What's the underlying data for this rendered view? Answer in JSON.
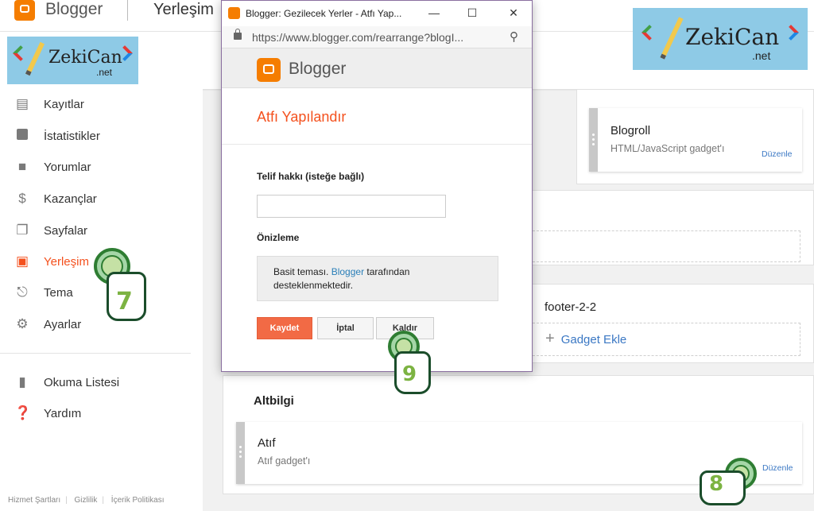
{
  "app": {
    "brand": "Blogger",
    "page_title": "Yerleşim"
  },
  "sidebar": {
    "items": [
      {
        "label": "Kayıtlar",
        "icon": "posts-icon"
      },
      {
        "label": "İstatistikler",
        "icon": "stats-icon"
      },
      {
        "label": "Yorumlar",
        "icon": "comments-icon"
      },
      {
        "label": "Kazançlar",
        "icon": "dollar-icon"
      },
      {
        "label": "Sayfalar",
        "icon": "pages-icon"
      },
      {
        "label": "Yerleşim",
        "icon": "layout-icon",
        "active": true
      },
      {
        "label": "Tema",
        "icon": "paint-roller-icon"
      },
      {
        "label": "Ayarlar",
        "icon": "gear-icon"
      }
    ],
    "secondary": [
      {
        "label": "Okuma Listesi",
        "icon": "bookmark-icon"
      },
      {
        "label": "Yardım",
        "icon": "help-icon"
      }
    ],
    "footer_links": [
      "Hizmet Şartları",
      "Gizlilik",
      "İçerik Politikası"
    ]
  },
  "main": {
    "sidebar_right_3": {
      "gadget_title": "Blogroll",
      "gadget_sub": "HTML/JavaScript gadget'ı",
      "edit": "Düzenle"
    },
    "footer_2_2": {
      "heading": "footer-2-2",
      "add_gadget": "Gadget Ekle"
    },
    "altbilgi": {
      "heading": "Altbilgi",
      "gadget_title": "Atıf",
      "gadget_sub": "Atıf gadget'ı",
      "edit": "Düzenle"
    }
  },
  "popup": {
    "window_title": "Blogger: Gezilecek Yerler - Atfı Yap...",
    "url": "https://www.blogger.com/rearrange?blogI...",
    "brand": "Blogger",
    "heading": "Atfı Yapılandır",
    "copyright_label": "Telif hakkı (isteğe bağlı)",
    "copyright_value": "",
    "preview_label": "Önizleme",
    "preview_text_before": "Basit teması. ",
    "preview_link": "Blogger",
    "preview_text_after": " tarafından desteklenmektedir.",
    "buttons": {
      "save": "Kaydet",
      "cancel": "İptal",
      "remove": "Kaldır"
    }
  },
  "watermark": {
    "name": "ZekiCan",
    "suffix": ".net"
  },
  "steps": [
    "7",
    "8",
    "9"
  ],
  "colors": {
    "accent": "#f4511e",
    "brand_orange": "#f57d00",
    "link": "#3b78c4",
    "save_button": "#f26a45"
  }
}
